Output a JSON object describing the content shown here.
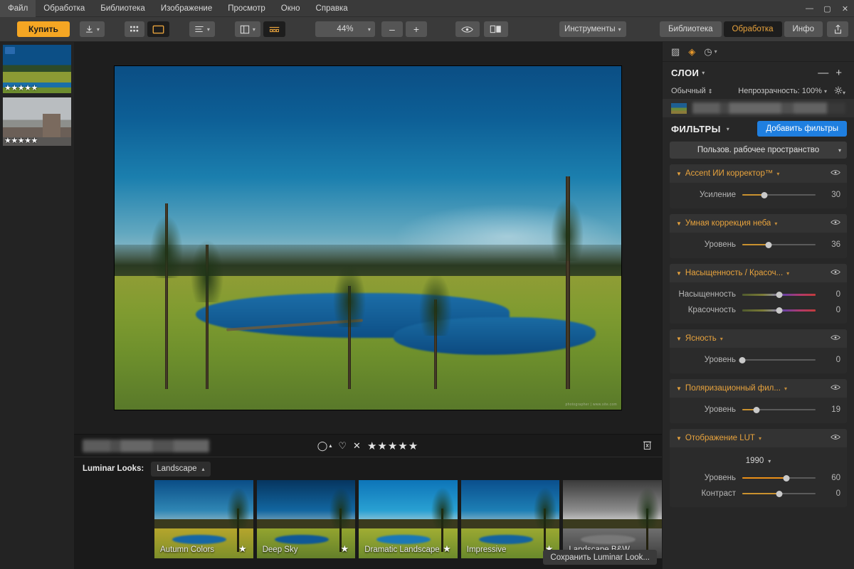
{
  "app": {
    "menu": [
      "Файл",
      "Обработка",
      "Библиотека",
      "Изображение",
      "Просмотр",
      "Окно",
      "Справка"
    ],
    "window_controls": {
      "minimize": "—",
      "maximize": "▢",
      "close": "✕"
    }
  },
  "toolbar": {
    "buy_label": "Купить",
    "export_icon": "download-icon",
    "grid_icon": "grid-view-icon",
    "single_icon": "single-image-view-icon",
    "list_icon": "list-view-icon",
    "panel_icon": "side-panel-icon",
    "filmstrip_icon": "filmstrip-icon",
    "zoom_value": "44%",
    "zoom_out": "–",
    "zoom_in": "+",
    "preview_icon": "eye-icon",
    "compare_icon": "before-after-icon",
    "tools_label": "Инструменты",
    "tabs": [
      {
        "label": "Библиотека",
        "active": false
      },
      {
        "label": "Обработка",
        "active": true
      },
      {
        "label": "Инфо",
        "active": false
      }
    ],
    "share_icon": "share-icon"
  },
  "filmstrip": {
    "items": [
      {
        "name": "thumbnail-marsh-lake",
        "selected": true,
        "stars": "★★★★★"
      },
      {
        "name": "thumbnail-city-street",
        "selected": false,
        "stars": "★★★★★"
      }
    ]
  },
  "canvas": {
    "watermark": "photographer | www.site.com"
  },
  "infobar": {
    "filename_blurred": true,
    "flag_icon": "◯",
    "favorite_icon": "♡",
    "reject_icon": "✕",
    "stars": "★★★★★",
    "delete_icon": "🗑"
  },
  "looks": {
    "label": "Luminar Looks:",
    "category": "Landscape",
    "save_label": "Сохранить Luminar Look...",
    "items": [
      {
        "name": "Autumn Colors",
        "sky": "linear-gradient(to bottom,#0a4d86,#2f86b4 70%,#8fb8c6)",
        "ground": "linear-gradient(to bottom,#b5a52c,#7d8f2a)",
        "lake": "#1666a5",
        "favorite": "★"
      },
      {
        "name": "Deep Sky",
        "sky": "linear-gradient(to bottom,#06355f,#1266a0 70%,#7fa9bd)",
        "ground": "linear-gradient(to bottom,#93a42f,#64802a)",
        "lake": "#0f5896",
        "favorite": "★"
      },
      {
        "name": "Dramatic Landscape",
        "sky": "linear-gradient(to bottom,#0d74b8,#29a0d2 70%,#9ecbd8)",
        "ground": "linear-gradient(to bottom,#a0ad33,#6d8b2c)",
        "lake": "#1a78b6",
        "favorite": "★"
      },
      {
        "name": "Impressive",
        "sky": "linear-gradient(to bottom,#0a4f8d,#1d7fb5 70%,#8fb9c9)",
        "ground": "linear-gradient(to bottom,#9aa832,#6a8a2b)",
        "lake": "#14639e",
        "favorite": "★"
      },
      {
        "name": "Landscape B&W",
        "sky": "linear-gradient(to bottom,#3a3a3a,#8d8d8d 70%,#d4d4d4)",
        "ground": "linear-gradient(to bottom,#6e6e6e,#3e3e3e)",
        "lake": "#787878",
        "favorite": ""
      }
    ]
  },
  "right_panel": {
    "icons": [
      {
        "name": "histogram-icon",
        "glyph": "▨",
        "active": false
      },
      {
        "name": "layers-icon",
        "glyph": "◈",
        "active": true
      },
      {
        "name": "history-icon",
        "glyph": "◷",
        "active": false
      }
    ],
    "layers": {
      "title": "СЛОИ",
      "remove": "—",
      "add": "+",
      "blend_mode": "Обычный",
      "opacity_label": "Непрозрачность: 100%",
      "settings_icon": "gear-icon"
    },
    "filters": {
      "title": "ФИЛЬТРЫ",
      "add_label": "Добавить фильтры",
      "workspace": "Пользов. рабочее пространство",
      "items": [
        {
          "title": "Accent ИИ корректор™",
          "eye": "◉",
          "sliders": [
            {
              "label": "Усиление",
              "value": "30",
              "pct": 30,
              "style": "amber"
            }
          ]
        },
        {
          "title": "Умная коррекция неба",
          "eye": "◉",
          "sliders": [
            {
              "label": "Уровень",
              "value": "36",
              "pct": 36,
              "style": "amber"
            }
          ]
        },
        {
          "title": "Насыщенность / Красоч...",
          "eye": "◉",
          "sliders": [
            {
              "label": "Насыщенность",
              "value": "0",
              "pct": 50,
              "style": "rainbow"
            },
            {
              "label": "Красочность",
              "value": "0",
              "pct": 50,
              "style": "rainbow"
            }
          ]
        },
        {
          "title": "Ясность",
          "eye": "◉",
          "sliders": [
            {
              "label": "Уровень",
              "value": "0",
              "pct": 0,
              "style": "plain"
            }
          ]
        },
        {
          "title": "Поляризационный фил...",
          "eye": "◉",
          "sliders": [
            {
              "label": "Уровень",
              "value": "19",
              "pct": 19,
              "style": "amber"
            }
          ]
        },
        {
          "title": "Отображение LUT",
          "eye": "◉",
          "lut_preset": "1990",
          "sliders": [
            {
              "label": "Уровень",
              "value": "60",
              "pct": 60,
              "style": "orange"
            },
            {
              "label": "Контраст",
              "value": "0",
              "pct": 50,
              "style": "plain"
            }
          ]
        }
      ]
    }
  },
  "colors": {
    "accent_orange": "#e8a33d",
    "buy_orange": "#f5a623",
    "add_blue": "#1f7fe0",
    "panel_bg": "#272727",
    "toolbar_bg": "#3a3a3a"
  }
}
